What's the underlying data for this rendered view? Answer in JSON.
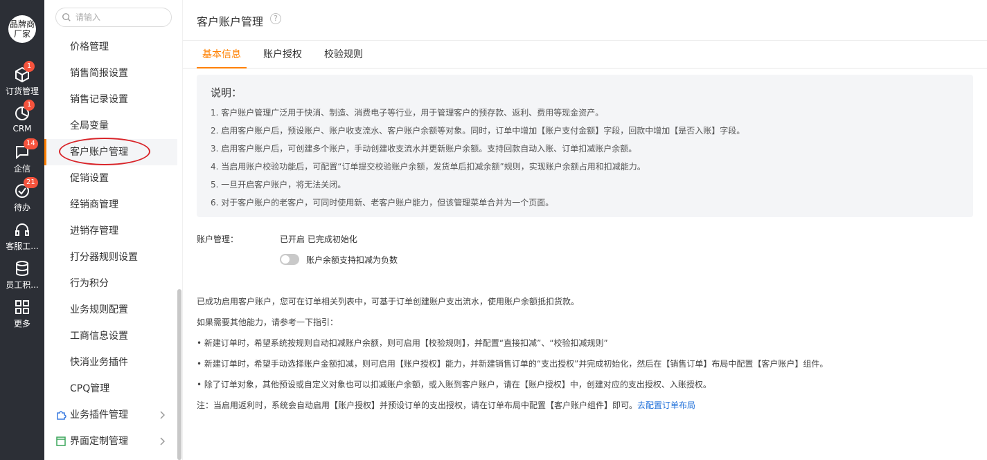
{
  "rail": {
    "brand": "品牌商厂家",
    "items": [
      {
        "label": "订货管理",
        "badge": "1",
        "icon": "box-icon"
      },
      {
        "label": "CRM",
        "badge": "1",
        "icon": "pie-chart-icon"
      },
      {
        "label": "企信",
        "badge": "14",
        "icon": "chat-bubble-icon"
      },
      {
        "label": "待办",
        "badge": "21",
        "icon": "check-circle-icon"
      },
      {
        "label": "客服工...",
        "badge": "",
        "icon": "headset-icon"
      },
      {
        "label": "员工积...",
        "badge": "",
        "icon": "database-icon"
      },
      {
        "label": "更多",
        "badge": "",
        "icon": "grid-icon"
      }
    ]
  },
  "submenu": {
    "search_placeholder": "请输入",
    "items": [
      "价格管理",
      "销售简报设置",
      "销售记录设置",
      "全局变量",
      "客户账户管理",
      "促销设置",
      "经销商管理",
      "进销存管理",
      "打分器规则设置",
      "行为积分",
      "业务规则配置",
      "工商信息设置",
      "快消业务插件",
      "CPQ管理"
    ],
    "active_index": 4,
    "groups": [
      {
        "label": "业务插件管理",
        "icon": "puzzle-icon"
      },
      {
        "label": "界面定制管理",
        "icon": "layout-icon"
      }
    ]
  },
  "main": {
    "title": "客户账户管理",
    "help": "?",
    "tabs": [
      "基本信息",
      "账户授权",
      "校验规则"
    ],
    "active_tab": 0,
    "note": {
      "title": "说明：",
      "lines": [
        "1. 客户账户管理广泛用于快消、制造、消费电子等行业，用于管理客户的预存款、返利、费用等现金资产。",
        "2. 启用客户账户后，预设账户、账户收支流水、客户账户余额等对象。同时，订单中增加【账户支付金额】字段，回款中增加【是否入账】字段。",
        "3. 启用客户账户后，可创建多个账户，手动创建收支流水并更新账户余额。支持回款自动入账、订单扣减账户余额。",
        "4. 当启用账户校验功能后，可配置“订单提交校验账户余额，发货单后扣减余额”规则，实现账户余额占用和扣减能力。",
        "5. 一旦开启客户账户，将无法关闭。",
        "6. 对于客户账户的老客户，可同时使用新、老客户账户能力，但该管理菜单合并为一个页面。"
      ]
    },
    "account": {
      "label": "账户管理：",
      "status": "已开启  已完成初始化",
      "toggle_label": "账户余额支持扣减为负数",
      "toggle_on": false
    },
    "info": [
      "已成功启用客户账户，您可在订单相关列表中，可基于订单创建账户支出流水，使用账户余额抵扣货款。",
      "如果需要其他能力，请参考一下指引：",
      "• 新建订单时，希望系统按规则自动扣减账户余额，则可启用【校验规则】，并配置“直接扣减”、“校验扣减规则”",
      "• 新建订单时，希望手动选择账户金额扣减，则可启用【账户授权】能力，并新建销售订单的“支出授权”并完成初始化，然后在【销售订单】布局中配置【客户账户】组件。",
      "• 除了订单对象，其他预设或自定义对象也可以扣减账户余额，或入账到客户账户，请在【账户授权】中，创建对应的支出授权、入账授权。"
    ],
    "footer_note": "注：当启用返利时，系统会自动启用【账户授权】并预设订单的支出授权，请在订单布局中配置【客户账户组件】即可。",
    "footer_link": "去配置订单布局"
  },
  "colors": {
    "accent": "#ff8000",
    "rail_bg": "#2c2f36",
    "badge": "#f5533d",
    "link": "#1e6fd9",
    "highlight": "#d9252a"
  }
}
